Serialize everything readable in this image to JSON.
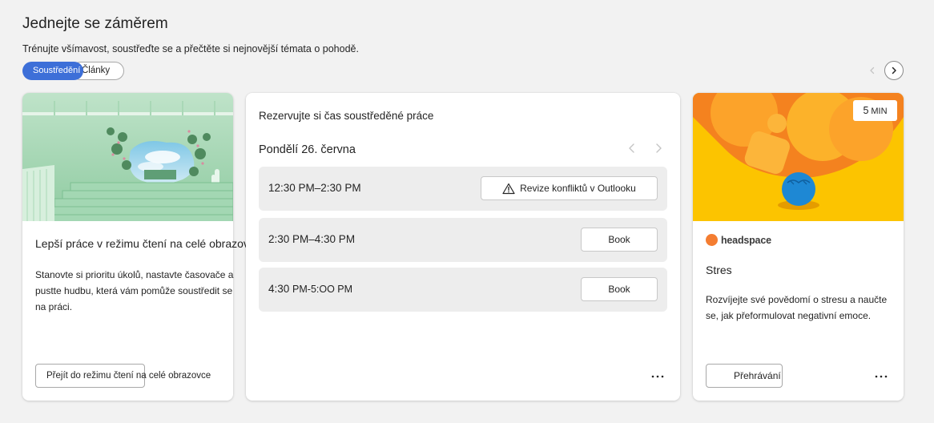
{
  "section": {
    "title": "Jednejte se záměrem",
    "subtitle": "Trénujte všímavost, soustřeďte se a přečtěte si nejnovější témata o pohodě."
  },
  "filters": {
    "active": "Soustředění",
    "other": "Články"
  },
  "card_focus_mode": {
    "title": "Lepší práce v režimu čtení na celé obrazovce",
    "description": "Stanovte si prioritu úkolů, nastavte časovače a pustte hudbu, která vám pomůže soustředit se na práci.",
    "button": "Přejít do režimu čtení na celé obrazovce"
  },
  "card_booking": {
    "title": "Rezervujte si čas soustředěné práce",
    "date": "Pondělí 26. června",
    "slots": [
      {
        "time": "12:30 PM–2:30 PM",
        "action": "Revize konfliktů v Outlooku"
      },
      {
        "time": "2:30 PM–4:30 PM",
        "action": "Book"
      },
      {
        "time_main": "4:30",
        "time_rest": "PM-5:OO PM",
        "action": "Book"
      }
    ]
  },
  "card_headspace": {
    "duration_value": "5",
    "duration_unit": "MIN",
    "brand": "headspace",
    "title": "Stres",
    "description": "Rozvíjejte své povědomí o stresu a naučte se, jak přeformulovat negativní emoce.",
    "button": "Přehrávání"
  },
  "colors": {
    "accent": "#3d6fd8",
    "background": "#f2f2f2",
    "slot_bg": "#ededed",
    "headspace_orange": "#f47d31",
    "headspace_yellow": "#fcc400"
  }
}
